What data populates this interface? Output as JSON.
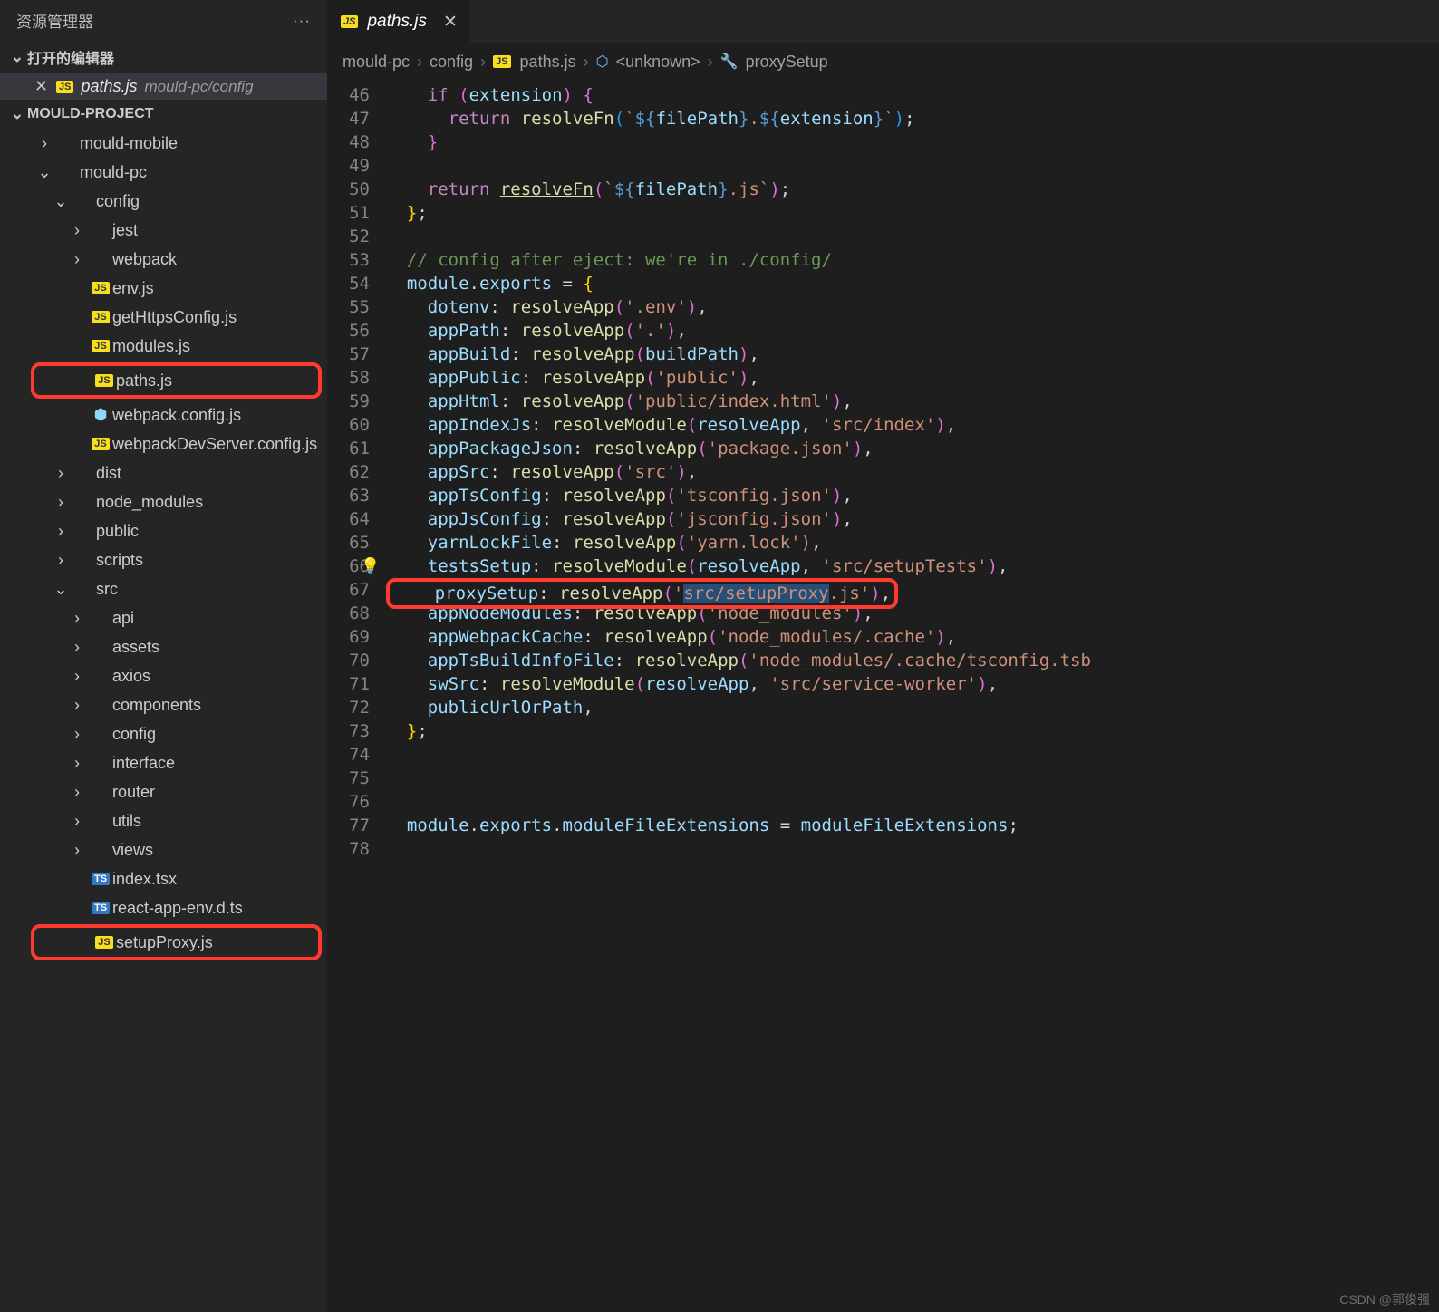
{
  "sidebar": {
    "title": "资源管理器",
    "open_editors_label": "打开的编辑器",
    "open_editor": {
      "file": "paths.js",
      "path": "mould-pc/config"
    },
    "project_label": "MOULD-PROJECT",
    "tree": [
      {
        "depth": 1,
        "kind": "folder-closed",
        "label": "mould-mobile"
      },
      {
        "depth": 1,
        "kind": "folder-open",
        "label": "mould-pc"
      },
      {
        "depth": 2,
        "kind": "folder-open",
        "label": "config"
      },
      {
        "depth": 3,
        "kind": "folder-closed",
        "label": "jest"
      },
      {
        "depth": 3,
        "kind": "folder-closed",
        "label": "webpack"
      },
      {
        "depth": 3,
        "kind": "js",
        "label": "env.js"
      },
      {
        "depth": 3,
        "kind": "js",
        "label": "getHttpsConfig.js"
      },
      {
        "depth": 3,
        "kind": "js",
        "label": "modules.js"
      },
      {
        "depth": 3,
        "kind": "js",
        "label": "paths.js",
        "highlight": true
      },
      {
        "depth": 3,
        "kind": "wp",
        "label": "webpack.config.js"
      },
      {
        "depth": 3,
        "kind": "js",
        "label": "webpackDevServer.config.js"
      },
      {
        "depth": 2,
        "kind": "folder-closed",
        "label": "dist"
      },
      {
        "depth": 2,
        "kind": "folder-closed",
        "label": "node_modules"
      },
      {
        "depth": 2,
        "kind": "folder-closed",
        "label": "public"
      },
      {
        "depth": 2,
        "kind": "folder-closed",
        "label": "scripts"
      },
      {
        "depth": 2,
        "kind": "folder-open",
        "label": "src"
      },
      {
        "depth": 3,
        "kind": "folder-closed",
        "label": "api"
      },
      {
        "depth": 3,
        "kind": "folder-closed",
        "label": "assets"
      },
      {
        "depth": 3,
        "kind": "folder-closed",
        "label": "axios"
      },
      {
        "depth": 3,
        "kind": "folder-closed",
        "label": "components"
      },
      {
        "depth": 3,
        "kind": "folder-closed",
        "label": "config"
      },
      {
        "depth": 3,
        "kind": "folder-closed",
        "label": "interface"
      },
      {
        "depth": 3,
        "kind": "folder-closed",
        "label": "router"
      },
      {
        "depth": 3,
        "kind": "folder-closed",
        "label": "utils"
      },
      {
        "depth": 3,
        "kind": "folder-closed",
        "label": "views"
      },
      {
        "depth": 3,
        "kind": "ts",
        "label": "index.tsx"
      },
      {
        "depth": 3,
        "kind": "ts",
        "label": "react-app-env.d.ts"
      },
      {
        "depth": 3,
        "kind": "js",
        "label": "setupProxy.js",
        "highlight": true
      }
    ]
  },
  "tab": {
    "file": "paths.js"
  },
  "breadcrumbs": {
    "parts": [
      "mould-pc",
      "config",
      "paths.js",
      "<unknown>",
      "proxySetup"
    ]
  },
  "code": {
    "first_line": 46,
    "lines": [
      {
        "n": 46,
        "html": "    <span class='k'>if</span> <span class='br2'>(</span><span class='v'>extension</span><span class='br2'>)</span> <span class='br2'>{</span>"
      },
      {
        "n": 47,
        "html": "      <span class='k'>return</span> <span class='fn'>resolveFn</span><span class='br3'>(</span><span class='s'>`</span><span class='kb'>${</span><span class='v'>filePath</span><span class='kb'>}</span><span class='s'>.</span><span class='kb'>${</span><span class='v'>extension</span><span class='kb'>}</span><span class='s'>`</span><span class='br3'>)</span><span class='p'>;</span>"
      },
      {
        "n": 48,
        "html": "    <span class='br2'>}</span>"
      },
      {
        "n": 49,
        "html": ""
      },
      {
        "n": 50,
        "html": "    <span class='k'>return</span> <span class='fn' style='text-decoration:underline'>resolveFn</span><span class='br2'>(</span><span class='s'>`</span><span class='kb'>${</span><span class='v'>filePath</span><span class='kb'>}</span><span class='s'>.js`</span><span class='br2'>)</span><span class='p'>;</span>"
      },
      {
        "n": 51,
        "html": "  <span class='br'>}</span><span class='p'>;</span>"
      },
      {
        "n": 52,
        "html": ""
      },
      {
        "n": 53,
        "html": "  <span class='cm'>// config after eject: we're in ./config/</span>"
      },
      {
        "n": 54,
        "html": "  <span class='v'>module</span><span class='p'>.</span><span class='v'>exports</span> <span class='op'>=</span> <span class='br'>{</span>"
      },
      {
        "n": 55,
        "html": "    <span class='v'>dotenv</span><span class='p'>:</span> <span class='fn'>resolveApp</span><span class='br2'>(</span><span class='s'>'.env'</span><span class='br2'>)</span><span class='p'>,</span>"
      },
      {
        "n": 56,
        "html": "    <span class='v'>appPath</span><span class='p'>:</span> <span class='fn'>resolveApp</span><span class='br2'>(</span><span class='s'>'.'</span><span class='br2'>)</span><span class='p'>,</span>"
      },
      {
        "n": 57,
        "html": "    <span class='v'>appBuild</span><span class='p'>:</span> <span class='fn'>resolveApp</span><span class='br2'>(</span><span class='v'>buildPath</span><span class='br2'>)</span><span class='p'>,</span>"
      },
      {
        "n": 58,
        "html": "    <span class='v'>appPublic</span><span class='p'>:</span> <span class='fn'>resolveApp</span><span class='br2'>(</span><span class='s'>'public'</span><span class='br2'>)</span><span class='p'>,</span>"
      },
      {
        "n": 59,
        "html": "    <span class='v'>appHtml</span><span class='p'>:</span> <span class='fn'>resolveApp</span><span class='br2'>(</span><span class='s'>'public/index.html'</span><span class='br2'>)</span><span class='p'>,</span>"
      },
      {
        "n": 60,
        "html": "    <span class='v'>appIndexJs</span><span class='p'>:</span> <span class='fn'>resolveModule</span><span class='br2'>(</span><span class='v'>resolveApp</span><span class='p'>,</span> <span class='s'>'src/index'</span><span class='br2'>)</span><span class='p'>,</span>"
      },
      {
        "n": 61,
        "html": "    <span class='v'>appPackageJson</span><span class='p'>:</span> <span class='fn'>resolveApp</span><span class='br2'>(</span><span class='s'>'package.json'</span><span class='br2'>)</span><span class='p'>,</span>"
      },
      {
        "n": 62,
        "html": "    <span class='v'>appSrc</span><span class='p'>:</span> <span class='fn'>resolveApp</span><span class='br2'>(</span><span class='s'>'src'</span><span class='br2'>)</span><span class='p'>,</span>"
      },
      {
        "n": 63,
        "html": "    <span class='v'>appTsConfig</span><span class='p'>:</span> <span class='fn'>resolveApp</span><span class='br2'>(</span><span class='s'>'tsconfig.json'</span><span class='br2'>)</span><span class='p'>,</span>"
      },
      {
        "n": 64,
        "html": "    <span class='v'>appJsConfig</span><span class='p'>:</span> <span class='fn'>resolveApp</span><span class='br2'>(</span><span class='s'>'jsconfig.json'</span><span class='br2'>)</span><span class='p'>,</span>"
      },
      {
        "n": 65,
        "html": "    <span class='v'>yarnLockFile</span><span class='p'>:</span> <span class='fn'>resolveApp</span><span class='br2'>(</span><span class='s'>'yarn.lock'</span><span class='br2'>)</span><span class='p'>,</span>"
      },
      {
        "n": 66,
        "html": "    <span class='v'>testsSetup</span><span class='p'>:</span> <span class='fn'>resolveModule</span><span class='br2'>(</span><span class='v'>resolveApp</span><span class='p'>,</span> <span class='s'>'src/setupTests'</span><span class='br2'>)</span><span class='p'>,</span>",
        "bulb": true
      },
      {
        "n": 67,
        "html": "    <span class='v'>proxySetup</span><span class='p'>:</span> <span class='fn'>resolveApp</span><span class='br2'>(</span><span class='s'>'<span class='sel'>src/setupProxy</span>.js'</span><span class='br2'>)</span><span class='p'>,</span>",
        "highlight": true
      },
      {
        "n": 68,
        "html": "    <span class='v'>appNodeModules</span><span class='p'>:</span> <span class='fn'>resolveApp</span><span class='br2'>(</span><span class='s'>'node_modules'</span><span class='br2'>)</span><span class='p'>,</span>"
      },
      {
        "n": 69,
        "html": "    <span class='v'>appWebpackCache</span><span class='p'>:</span> <span class='fn'>resolveApp</span><span class='br2'>(</span><span class='s'>'node_modules/.cache'</span><span class='br2'>)</span><span class='p'>,</span>"
      },
      {
        "n": 70,
        "html": "    <span class='v'>appTsBuildInfoFile</span><span class='p'>:</span> <span class='fn'>resolveApp</span><span class='br2'>(</span><span class='s'>'node_modules/.cache/tsconfig.tsb</span>"
      },
      {
        "n": 71,
        "html": "    <span class='v'>swSrc</span><span class='p'>:</span> <span class='fn'>resolveModule</span><span class='br2'>(</span><span class='v'>resolveApp</span><span class='p'>,</span> <span class='s'>'src/service-worker'</span><span class='br2'>)</span><span class='p'>,</span>"
      },
      {
        "n": 72,
        "html": "    <span class='v'>publicUrlOrPath</span><span class='p'>,</span>"
      },
      {
        "n": 73,
        "html": "  <span class='br'>}</span><span class='p'>;</span>"
      },
      {
        "n": 74,
        "html": ""
      },
      {
        "n": 75,
        "html": ""
      },
      {
        "n": 76,
        "html": ""
      },
      {
        "n": 77,
        "html": "  <span class='v'>module</span><span class='p'>.</span><span class='v'>exports</span><span class='p'>.</span><span class='v'>moduleFileExtensions</span> <span class='op'>=</span> <span class='v'>moduleFileExtensions</span><span class='p'>;</span>"
      },
      {
        "n": 78,
        "html": ""
      }
    ]
  },
  "watermark": "CSDN @郭俊强"
}
